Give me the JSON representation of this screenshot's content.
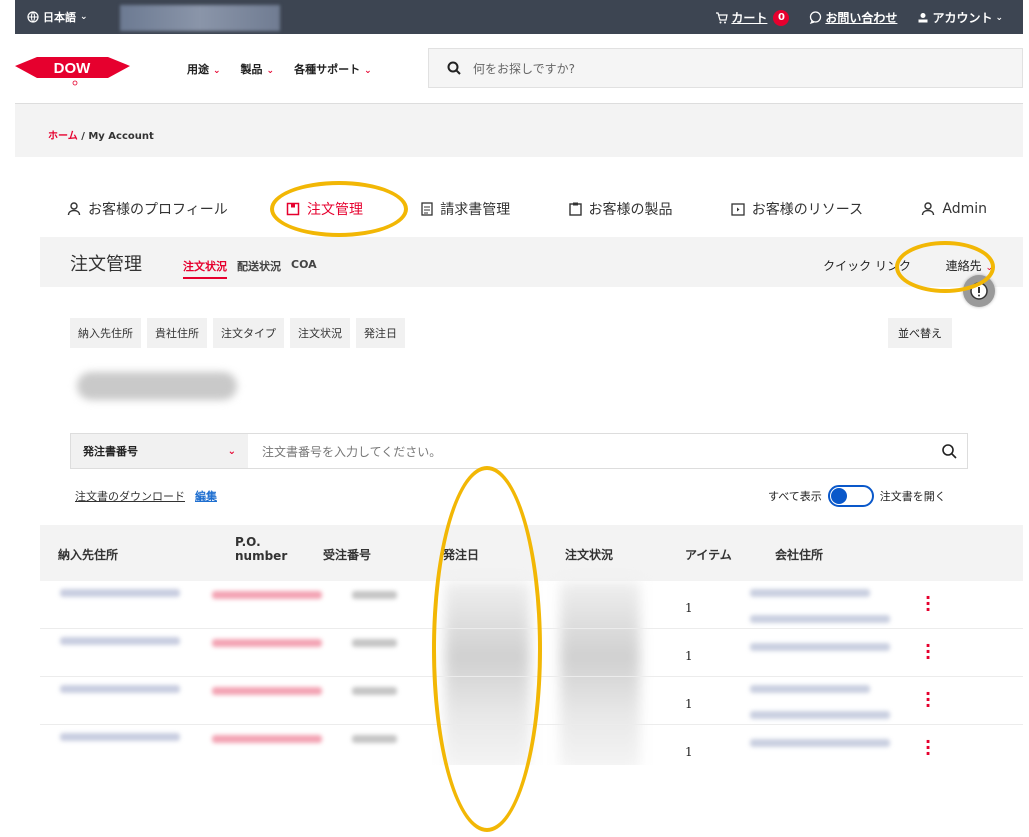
{
  "utilbar": {
    "language": "日本語",
    "cart_label": "カート",
    "cart_count": "0",
    "contact_label": "お問い合わせ",
    "account_label": "アカウント"
  },
  "header": {
    "logo_text": "DOW",
    "nav": [
      "用途",
      "製品",
      "各種サポート"
    ],
    "search_placeholder": "何をお探しですか?"
  },
  "breadcrumb": {
    "home": "ホーム",
    "separator": "/",
    "current": "My Account"
  },
  "tabs": [
    {
      "label": "お客様のプロフィール",
      "icon": "user-icon"
    },
    {
      "label": "注文管理",
      "icon": "order-icon",
      "active": true
    },
    {
      "label": "請求書管理",
      "icon": "invoice-icon"
    },
    {
      "label": "お客様の製品",
      "icon": "clipboard-icon"
    },
    {
      "label": "お客様のリソース",
      "icon": "resource-icon"
    },
    {
      "label": "Admin",
      "icon": "user-icon"
    }
  ],
  "section": {
    "title": "注文管理",
    "subtabs": [
      "注文状況",
      "配送状況",
      "COA"
    ],
    "quick_links": "クイック リンク",
    "contact": "連絡先"
  },
  "filters": [
    "納入先住所",
    "貴社住所",
    "注文タイプ",
    "注文状況",
    "発注日"
  ],
  "sort_label": "並べ替え",
  "search": {
    "select_value": "発注書番号",
    "placeholder": "注文書番号を入力してください。"
  },
  "actions": {
    "download": "注文書のダウンロード",
    "edit": "編集",
    "show_all": "すべて表示",
    "open_orders": "注文書を開く"
  },
  "table": {
    "headers": [
      "納入先住所",
      "P.O.",
      "number",
      "受注番号",
      "発注日",
      "注文状況",
      "アイテム",
      "会社住所"
    ],
    "rows": [
      {
        "items": "1"
      },
      {
        "items": "1"
      },
      {
        "items": "1"
      },
      {
        "items": "1"
      }
    ]
  },
  "colors": {
    "accent": "#e6002e",
    "annotation": "#f2b705",
    "link": "#1f6fd0"
  }
}
